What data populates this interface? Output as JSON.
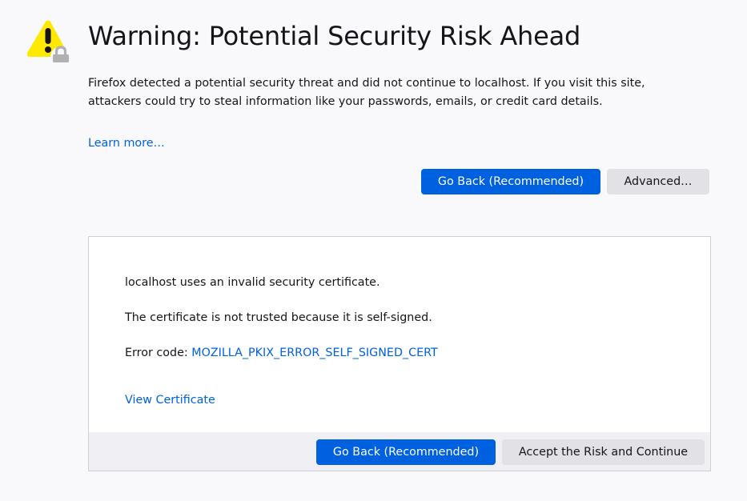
{
  "page": {
    "title": "Warning: Potential Security Risk Ahead",
    "intro": "Firefox detected a potential security threat and did not continue to localhost. If you visit this site, attackers could try to steal information like your passwords, emails, or credit card details.",
    "learn_more": "Learn more…",
    "icon": "warning-lock-icon"
  },
  "actions": {
    "go_back": "Go Back (Recommended)",
    "advanced": "Advanced…"
  },
  "advanced_panel": {
    "line1": "localhost uses an invalid security certificate.",
    "line2": "The certificate is not trusted because it is self-signed.",
    "error_code_label": "Error code: ",
    "error_code": "MOZILLA_PKIX_ERROR_SELF_SIGNED_CERT",
    "view_certificate": "View Certificate",
    "go_back": "Go Back (Recommended)",
    "accept": "Accept the Risk and Continue"
  },
  "colors": {
    "accent": "#0061e0",
    "warning": "#ffe900",
    "lock": "#b1b1b3",
    "background": "#f9f9fb"
  }
}
